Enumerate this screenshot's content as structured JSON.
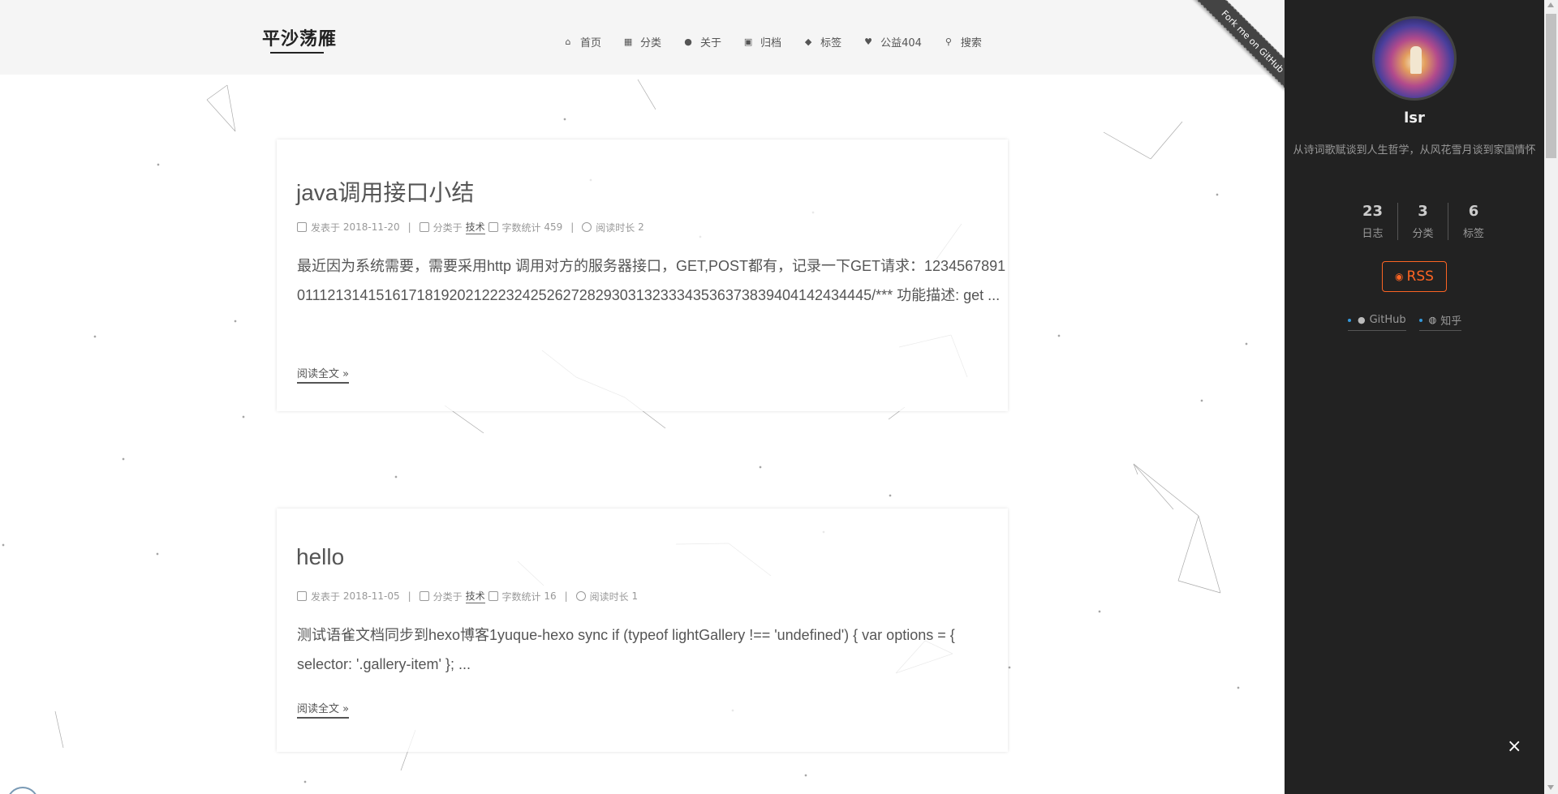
{
  "site": {
    "title": "平沙荡雁"
  },
  "nav": [
    {
      "label": "首页",
      "icon": "home-icon"
    },
    {
      "label": "分类",
      "icon": "grid-icon"
    },
    {
      "label": "关于",
      "icon": "user-icon"
    },
    {
      "label": "归档",
      "icon": "archive-icon"
    },
    {
      "label": "标签",
      "icon": "tags-icon"
    },
    {
      "label": "公益404",
      "icon": "heartbeat-icon"
    },
    {
      "label": "搜索",
      "icon": "search-icon"
    }
  ],
  "ribbon": "Fork me on GitHub",
  "posts": [
    {
      "title": "java调用接口小结",
      "posted_label": "发表于",
      "date": "2018-11-20",
      "category_label": "分类于",
      "category": "技术",
      "words_label": "字数统计",
      "words": "459",
      "read_label": "阅读时长",
      "read_time": "2",
      "excerpt": "最近因为系统需要，需要采用http 调用对方的服务器接口，GET,POST都有，记录一下GET请求：12345678910111213141516171819202122232425262728293031323334353637383940414243444​5/*** 功能描述: get ...",
      "more": "阅读全文 »"
    },
    {
      "title": "hello",
      "posted_label": "发表于",
      "date": "2018-11-05",
      "category_label": "分类于",
      "category": "技术",
      "words_label": "字数统计",
      "words": "16",
      "read_label": "阅读时长",
      "read_time": "1",
      "excerpt": "测试语雀文档同步到hexo博客1yuque-hexo sync if (typeof lightGallery !== 'undefined') { var options = { selector: '.gallery-item' }; ...",
      "more": "阅读全文 »"
    }
  ],
  "sidebar": {
    "author": "lsr",
    "motto": "从诗词歌赋谈到人生哲学，从风花雪月谈到家国情怀",
    "stats": [
      {
        "count": "23",
        "label": "日志"
      },
      {
        "count": "3",
        "label": "分类"
      },
      {
        "count": "6",
        "label": "标签"
      }
    ],
    "rss": "RSS",
    "links": [
      {
        "label": "GitHub",
        "icon": "github-icon"
      },
      {
        "label": "知乎",
        "icon": "globe-icon"
      }
    ],
    "close": "×"
  },
  "colors": {
    "accent": "#fc6423",
    "sidebar_bg": "#222222",
    "header_bg": "#f5f5f5",
    "link_dot": "#3498db"
  }
}
